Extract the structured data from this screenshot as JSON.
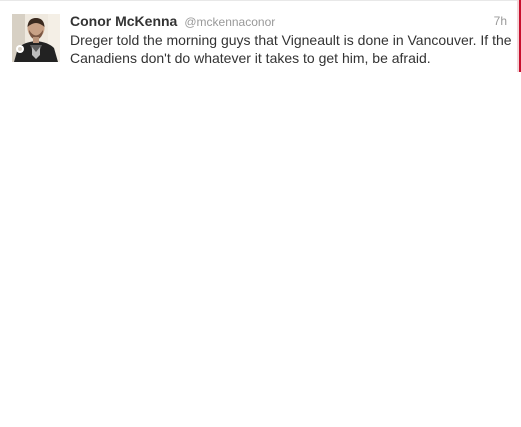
{
  "tweet": {
    "fullname": "Conor McKenna",
    "username": "@mckennaconor",
    "timestamp": "7h",
    "text": "Dreger told the morning guys that Vigneault is done in Vancouver. If the Canadiens don't do whatever it takes to get him, be afraid."
  },
  "colors": {
    "name": "#333333",
    "meta": "#999999",
    "accent": "#c8102e"
  },
  "icons": {
    "avatar": "profile-photo"
  }
}
